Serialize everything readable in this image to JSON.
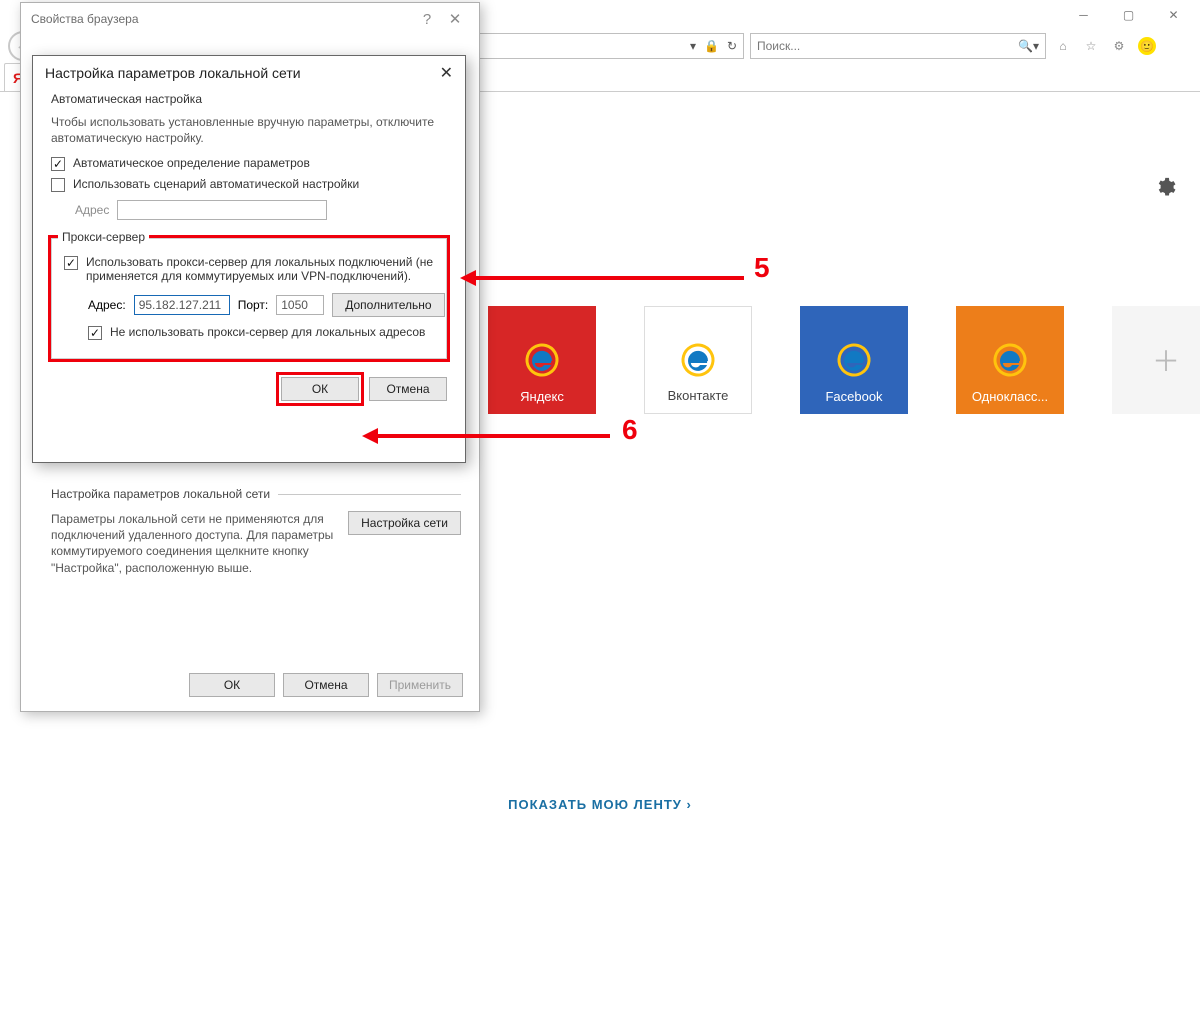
{
  "browser": {
    "search_placeholder": "Поиск...",
    "tab_label": "Я",
    "feed_link": "ПОКАЗАТЬ МОЮ ЛЕНТУ",
    "tiles": [
      {
        "label": "Яндекс",
        "color": "red"
      },
      {
        "label": "Вконтакте",
        "color": "white"
      },
      {
        "label": "Facebook",
        "color": "blue"
      },
      {
        "label": "Однокласс...",
        "color": "orange"
      }
    ]
  },
  "dlg_parent": {
    "title": "Свойства браузера",
    "lan_heading": "Настройка параметров локальной сети",
    "lan_desc": "Параметры локальной сети не применяются для подключений удаленного доступа. Для параметры коммутируемого соединения щелкните кнопку \"Настройка\", расположенную выше.",
    "lan_button": "Настройка сети",
    "ok": "ОК",
    "cancel": "Отмена",
    "apply": "Применить"
  },
  "dlg_child": {
    "title": "Настройка параметров локальной сети",
    "auto_heading": "Автоматическая настройка",
    "auto_desc": "Чтобы использовать установленные вручную параметры, отключите автоматическую настройку.",
    "auto_detect": "Автоматическое определение параметров",
    "use_script": "Использовать сценарий автоматической настройки",
    "script_addr_label": "Адрес",
    "proxy_heading": "Прокси-сервер",
    "proxy_use": "Использовать прокси-сервер для локальных подключений (не применяется для коммутируемых или VPN-подключений).",
    "proxy_addr_label": "Адрес:",
    "proxy_addr": "95.182.127.211",
    "proxy_port_label": "Порт:",
    "proxy_port": "1050",
    "advanced": "Дополнительно",
    "bypass_local": "Не использовать прокси-сервер для локальных адресов",
    "ok": "ОК",
    "cancel": "Отмена"
  },
  "annotations": {
    "badge5": "5",
    "badge6": "6"
  }
}
